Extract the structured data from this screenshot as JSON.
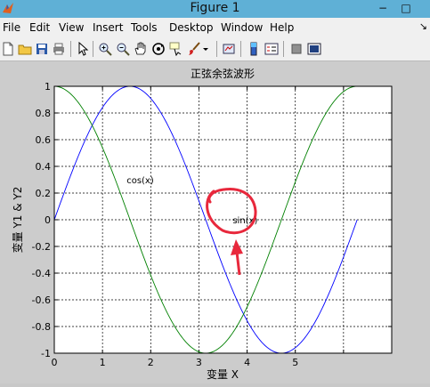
{
  "window": {
    "title": "Figure 1",
    "controls": {
      "minimize": "−",
      "maximize": "□"
    }
  },
  "menu": {
    "items": [
      {
        "label": "File",
        "key": "F"
      },
      {
        "label": "Edit",
        "key": "E"
      },
      {
        "label": "View",
        "key": "V"
      },
      {
        "label": "Insert",
        "key": "I"
      },
      {
        "label": "Tools",
        "key": "T"
      },
      {
        "label": "Desktop",
        "key": "D"
      },
      {
        "label": "Window",
        "key": "W"
      },
      {
        "label": "Help",
        "key": "H"
      }
    ],
    "overflow": "↘"
  },
  "toolbar": {
    "buttons": [
      {
        "name": "new-figure-icon"
      },
      {
        "name": "open-file-icon"
      },
      {
        "name": "save-figure-icon"
      },
      {
        "name": "print-figure-icon"
      },
      {
        "name": "edit-plot-arrow-icon"
      },
      {
        "name": "zoom-in-icon"
      },
      {
        "name": "zoom-out-icon"
      },
      {
        "name": "pan-hand-icon"
      },
      {
        "name": "rotate-3d-icon"
      },
      {
        "name": "data-cursor-icon"
      },
      {
        "name": "brush-icon"
      },
      {
        "name": "link-plot-icon"
      },
      {
        "name": "insert-colorbar-icon"
      },
      {
        "name": "insert-legend-icon"
      },
      {
        "name": "hide-plot-tools-icon"
      },
      {
        "name": "show-plot-tools-icon"
      }
    ]
  },
  "chart_data": {
    "type": "line",
    "title": "正弦余弦波形",
    "xlabel": "变量 X",
    "ylabel": "变量 Y1 & Y2",
    "xlim": [
      0,
      7
    ],
    "ylim": [
      -1,
      1
    ],
    "xticks": [
      0,
      1,
      2,
      3,
      4,
      5,
      6,
      7
    ],
    "xtick_labels": [
      "0",
      "1",
      "2",
      "3",
      "4",
      "5",
      "",
      ""
    ],
    "yticks": [
      -1,
      -0.8,
      -0.6,
      -0.4,
      -0.2,
      0,
      0.2,
      0.4,
      0.6,
      0.8,
      1
    ],
    "ytick_labels": [
      "-1",
      "-0.8",
      "-0.6",
      "-0.4",
      "-0.2",
      "0",
      "0.2",
      "0.4",
      "0.6",
      "0.8",
      "1"
    ],
    "grid": true,
    "grid_style": "dashed",
    "series": [
      {
        "name": "sin(x)",
        "function": "sin",
        "x_range": [
          0,
          6.283
        ],
        "color": "#0000ff"
      },
      {
        "name": "cos(x)",
        "function": "cos",
        "x_range": [
          0,
          6.283
        ],
        "color": "#008000"
      }
    ],
    "annotations": [
      {
        "text": "cos(x)",
        "x": 1.5,
        "y": 0.3
      },
      {
        "text": "sin(x)",
        "x": 3.7,
        "y": 0.0
      }
    ],
    "markup": {
      "circle_color": "#e8283c",
      "arrow_color": "#e8283c"
    }
  }
}
